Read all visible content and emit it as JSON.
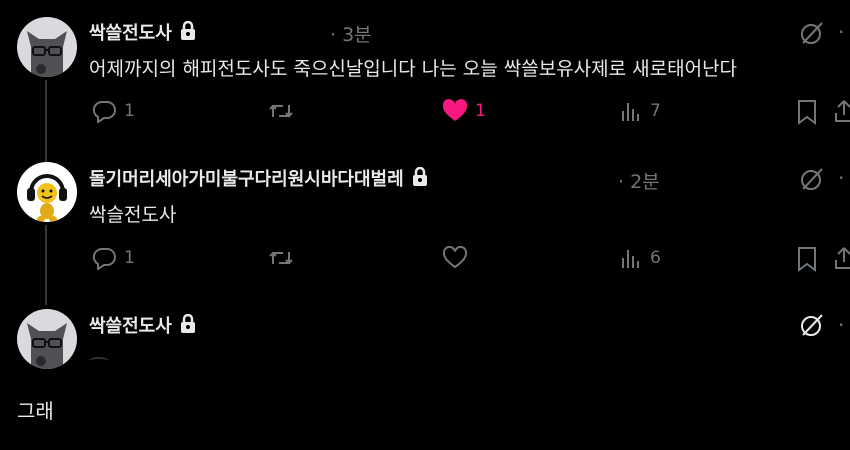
{
  "posts": [
    {
      "author": "싹쓸전도사",
      "time": "· 3분",
      "text": "어제까지의 해피전도사도 죽으신날입니다 나는 오늘 싹쓸보유사제로 새로태어난다",
      "replies": "1",
      "likes": "1",
      "views": "7"
    },
    {
      "author": "돌기머리세아가미불구다리원시바다대벌레",
      "time": "· 2분",
      "text": "싹슬전도사",
      "replies": "1",
      "likes": "",
      "views": "6"
    },
    {
      "author": "싹쓸전도사",
      "time": "",
      "text": "",
      "replies": "",
      "likes": "",
      "views": ""
    }
  ],
  "reply_text": "그래",
  "colors": {
    "background": "#000000",
    "text": "#e7e9ea",
    "muted": "#71767b",
    "like": "#f91880"
  },
  "icons": [
    "lock-icon",
    "grok-icon",
    "more-icon",
    "reply-icon",
    "retweet-icon",
    "heart-icon",
    "views-icon",
    "bookmark-icon",
    "share-icon"
  ]
}
